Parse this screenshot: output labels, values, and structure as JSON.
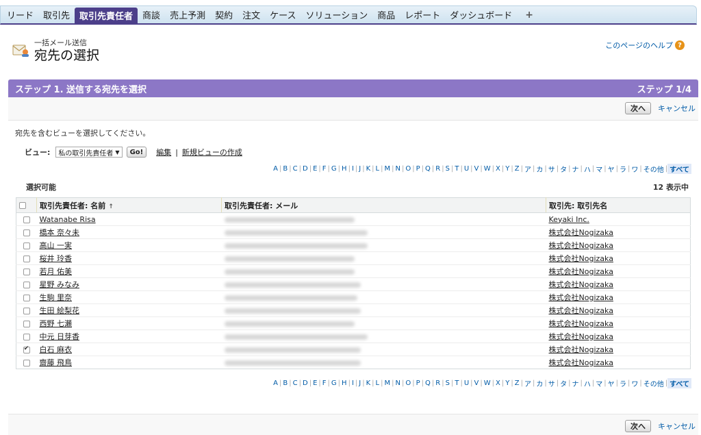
{
  "tabs": [
    {
      "label": "リード"
    },
    {
      "label": "取引先"
    },
    {
      "label": "取引先責任者",
      "active": true
    },
    {
      "label": "商談"
    },
    {
      "label": "売上予測"
    },
    {
      "label": "契約"
    },
    {
      "label": "注文"
    },
    {
      "label": "ケース"
    },
    {
      "label": "ソリューション"
    },
    {
      "label": "商品"
    },
    {
      "label": "レポート"
    },
    {
      "label": "ダッシュボード"
    },
    {
      "label": "+"
    }
  ],
  "header": {
    "kicker": "一括メール送信",
    "title": "宛先の選択",
    "help": "このページのヘルプ",
    "help_icon": "question-icon"
  },
  "step": {
    "title": "ステップ 1. 送信する宛先を選択",
    "indicator": "ステップ 1/4",
    "next": "次へ",
    "cancel": "キャンセル",
    "instruction": "宛先を含むビューを選択してください。"
  },
  "view": {
    "label": "ビュー:",
    "selected": "私の取引先責任者",
    "go": "Go!",
    "edit": "編集",
    "sep": "|",
    "new_view": "新規ビューの作成"
  },
  "alphabet": [
    "A",
    "B",
    "C",
    "D",
    "E",
    "F",
    "G",
    "H",
    "I",
    "J",
    "K",
    "L",
    "M",
    "N",
    "O",
    "P",
    "Q",
    "R",
    "S",
    "T",
    "U",
    "V",
    "W",
    "X",
    "Y",
    "Z",
    "ア",
    "カ",
    "サ",
    "タ",
    "ナ",
    "ハ",
    "マ",
    "ヤ",
    "ラ",
    "ワ",
    "その他",
    "すべて"
  ],
  "alphabet_current": "すべて",
  "list": {
    "available": "選択可能",
    "count": "12 表示中",
    "columns": [
      "取引先責任者: 名前",
      "取引先責任者: メール",
      "取引先: 取引先名"
    ],
    "sort_indicator": "↑",
    "rows": [
      {
        "name": "Watanabe Risa",
        "account": "Keyaki Inc.",
        "checked": false,
        "mail_len": 0.4
      },
      {
        "name": "橋本 奈々未",
        "account": "株式会社Nogizaka",
        "checked": false,
        "mail_len": 0.44
      },
      {
        "name": "高山 一実",
        "account": "株式会社Nogizaka",
        "checked": false,
        "mail_len": 0.44
      },
      {
        "name": "桜井 玲香",
        "account": "株式会社Nogizaka",
        "checked": false,
        "mail_len": 0.4
      },
      {
        "name": "若月 佑美",
        "account": "株式会社Nogizaka",
        "checked": false,
        "mail_len": 0.4
      },
      {
        "name": "星野 みなみ",
        "account": "株式会社Nogizaka",
        "checked": false,
        "mail_len": 0.42
      },
      {
        "name": "生駒 里奈",
        "account": "株式会社Nogizaka",
        "checked": false,
        "mail_len": 0.41
      },
      {
        "name": "生田 絵梨花",
        "account": "株式会社Nogizaka",
        "checked": false,
        "mail_len": 0.42
      },
      {
        "name": "西野 七瀬",
        "account": "株式会社Nogizaka",
        "checked": false,
        "mail_len": 0.4
      },
      {
        "name": "中元 日芽香",
        "account": "株式会社Nogizaka",
        "checked": false,
        "mail_len": 0.44
      },
      {
        "name": "白石 麻衣",
        "account": "株式会社Nogizaka",
        "checked": true,
        "mail_len": 0.42
      },
      {
        "name": "齋藤 飛鳥",
        "account": "株式会社Nogizaka",
        "checked": false,
        "mail_len": 0.42
      }
    ]
  }
}
